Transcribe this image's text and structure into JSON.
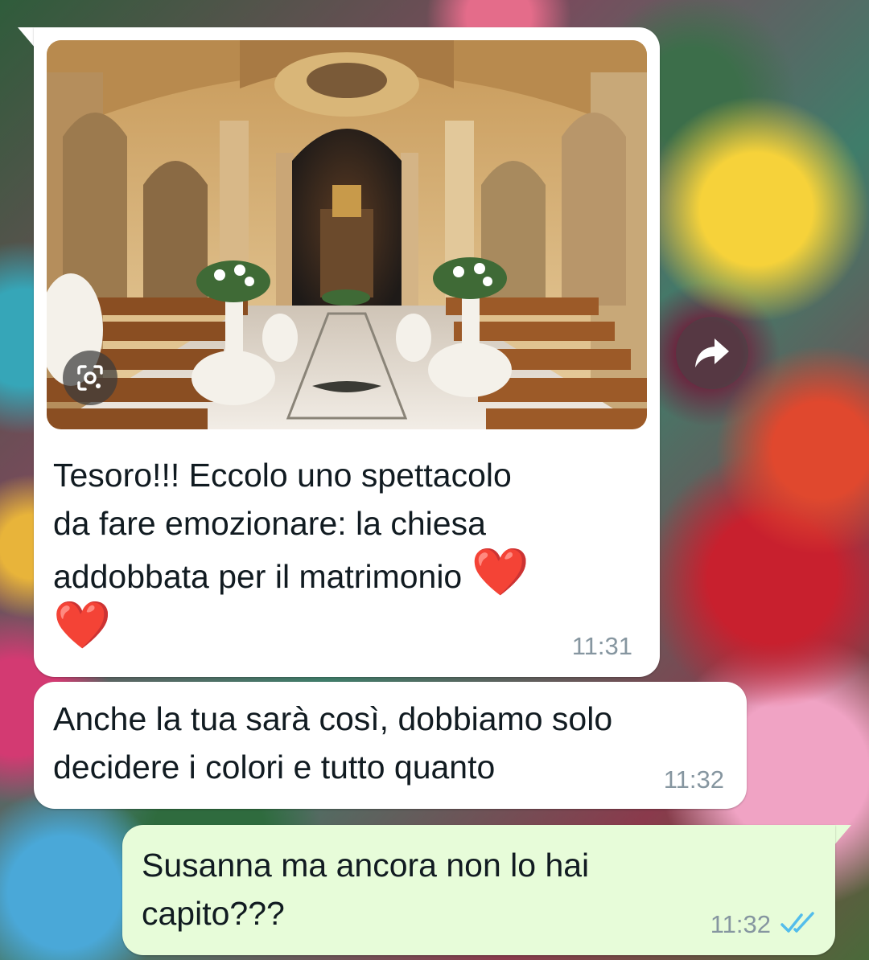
{
  "colors": {
    "incoming_bubble": "#ffffff",
    "outgoing_bubble": "#e7fcd9",
    "timestamp": "#8696a0",
    "read_ticks": "#53bdeb",
    "heart": "#e01b2a"
  },
  "messages": [
    {
      "direction": "incoming",
      "has_image": true,
      "image_subject": "church interior decorated for a wedding",
      "text_lines": [
        "Tesoro!!! Eccolo uno spettacolo",
        "da fare emozionare: la chiesa",
        "addobbata per il matrimonio"
      ],
      "emoji": "❤️",
      "time": "11:31"
    },
    {
      "direction": "incoming",
      "has_image": false,
      "text_lines": [
        "Anche la tua sarà così, dobbiamo solo",
        "decidere i colori e tutto quanto"
      ],
      "time": "11:32"
    },
    {
      "direction": "outgoing",
      "has_image": false,
      "text_lines": [
        "Susanna ma ancora non lo hai",
        "capito???"
      ],
      "time": "11:32",
      "status": "read"
    }
  ],
  "icons": {
    "lens": "google-lens-icon",
    "forward": "forward-arrow-icon",
    "read_receipt": "double-check-icon"
  }
}
